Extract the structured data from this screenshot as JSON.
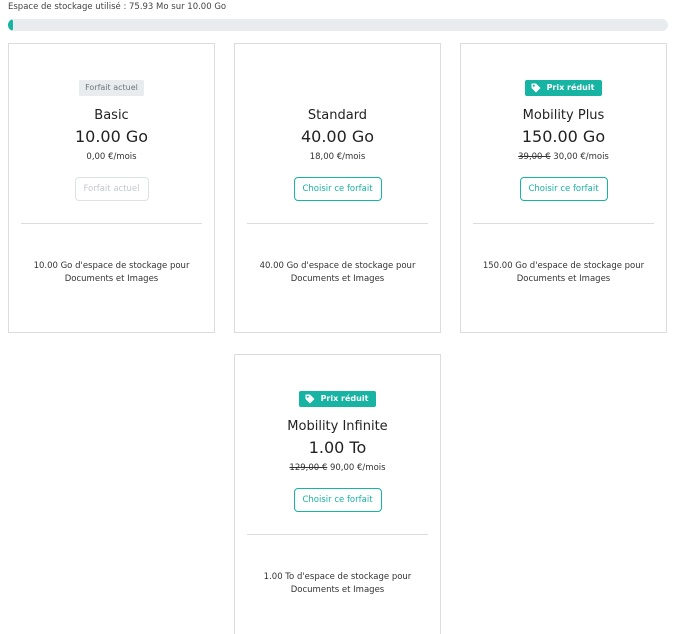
{
  "storage": {
    "usage_label": "Espace de stockage utilisé : 75.93 Mo sur 10.00 Go",
    "used_fraction": 0.0074,
    "fill_color": "#17b3a3"
  },
  "badges": {
    "current": "Forfait actuel",
    "promo": "Prix réduit",
    "promo_icon": "tag-icon"
  },
  "plans": [
    {
      "name": "Basic",
      "size": "10.00 Go",
      "old_price": "",
      "price": "0,00 €/mois",
      "button_label": "Forfait actuel",
      "description": "10.00 Go d'espace de stockage pour Documents et Images"
    },
    {
      "name": "Standard",
      "size": "40.00 Go",
      "old_price": "",
      "price": "18,00 €/mois",
      "button_label": "Choisir ce forfait",
      "description": "40.00 Go d'espace de stockage pour Documents et Images"
    },
    {
      "name": "Mobility Plus",
      "size": "150.00 Go",
      "old_price": "39,00 €",
      "price": "30,00 €/mois",
      "button_label": "Choisir ce forfait",
      "description": "150.00 Go d'espace de stockage pour Documents et Images"
    },
    {
      "name": "Mobility Infinite",
      "size": "1.00 To",
      "old_price": "129,00 €",
      "price": "90,00 €/mois",
      "button_label": "Choisir ce forfait",
      "description": "1.00 To d'espace de stockage pour Documents et Images"
    }
  ],
  "colors": {
    "accent": "#17b3a3",
    "badge_current_bg": "#e9ecef",
    "border": "#dcdcdc"
  }
}
